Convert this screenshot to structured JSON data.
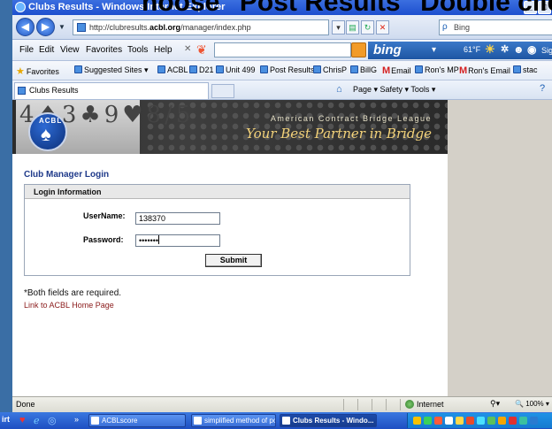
{
  "overlay": {
    "heading": "hoose \"Post Results\" Double click on it."
  },
  "window": {
    "title": "Clubs Results - Windows Internet Explorer"
  },
  "address": {
    "url_prefix": "http://clubresults.",
    "url_domain": "acbl.org",
    "url_path": "/manager/index.php",
    "search_placeholder": "Bing"
  },
  "menu": {
    "items": [
      "File",
      "Edit",
      "View",
      "Favorites",
      "Tools",
      "Help"
    ],
    "bing_label": "bing",
    "temp": "61°F",
    "sign_in": "Sign"
  },
  "favorites": {
    "label": "Favorites",
    "items": [
      "Suggested Sites ▾",
      "ACBL",
      "D21",
      "Unit 499",
      "Post Results",
      "ChrisP",
      "BillG",
      "Email",
      "Ron's MP",
      "Ron's Email",
      "stac"
    ]
  },
  "tabs": {
    "active_title": "Clubs Results",
    "tools_text": "Page ▾   Safety ▾   Tools ▾"
  },
  "banner": {
    "logo_text": "ACBL",
    "title": "American Contract Bridge League",
    "tagline": "Your Best Partner in Bridge"
  },
  "login": {
    "page_heading": "Club Manager Login",
    "box_title": "Login Information",
    "username_label": "UserName:",
    "username_value": "138370",
    "password_label": "Password:",
    "password_mask": "•••••••",
    "submit_label": "Submit",
    "required_note": "*Both fields are required.",
    "home_link": "Link to ACBL Home Page"
  },
  "status": {
    "text": "Done",
    "zone": "Internet",
    "zoom": "100%"
  },
  "taskbar": {
    "start": "irt",
    "buttons": [
      "ACBLscore",
      "simplified method of post...",
      "Clubs Results - Windo..."
    ]
  },
  "colors": {
    "title_bar": "#1d4fcf",
    "link": "#8a1a1a",
    "heading": "#1f3a8a",
    "bing_orange": "#f29b28"
  }
}
